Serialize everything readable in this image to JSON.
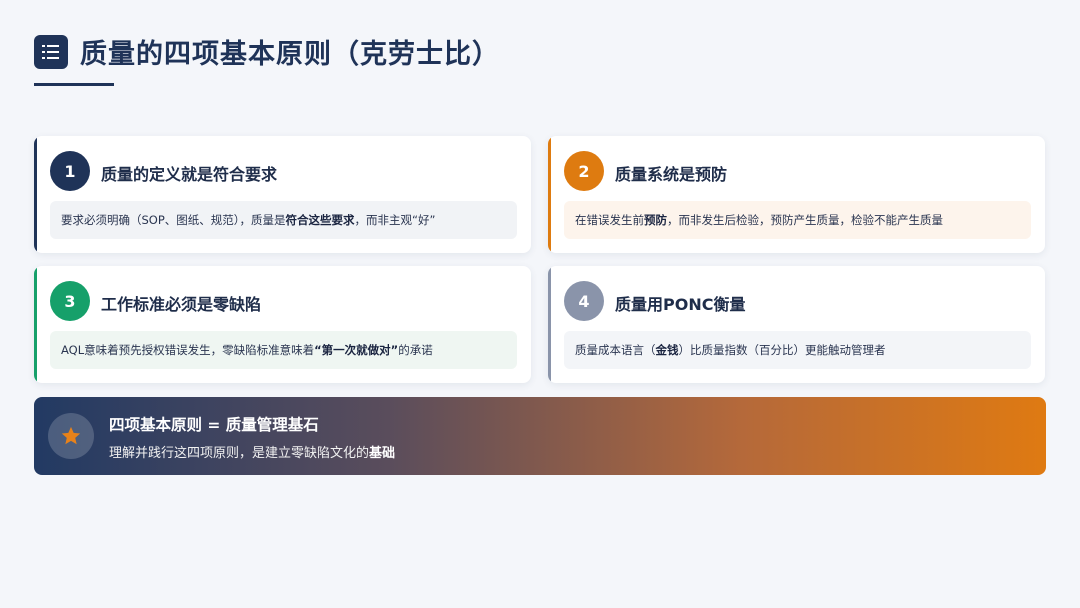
{
  "title": "质量的四项基本原则（克劳士比）",
  "title_icon": "list-icon",
  "colors": {
    "navy": "#1f3358",
    "orange": "#de7b10",
    "green": "#16a06a",
    "gray": "#8a94aa"
  },
  "cards": [
    {
      "number": "1",
      "heading": "质量的定义就是符合要求",
      "desc_before": "要求必须明确（SOP、图纸、规范），质量是",
      "desc_bold": "符合这些要求",
      "desc_after": "，而非主观“好”"
    },
    {
      "number": "2",
      "heading": "质量系统是预防",
      "desc_before": "在错误发生前",
      "desc_bold": "预防",
      "desc_after": "，而非发生后检验，预防产生质量，检验不能产生质量"
    },
    {
      "number": "3",
      "heading": "工作标准必须是零缺陷",
      "desc_before": "AQL意味着预先授权错误发生，零缺陷标准意味着",
      "desc_bold": "“第一次就做对”",
      "desc_after": "的承诺"
    },
    {
      "number": "4",
      "heading": "质量用PONC衡量",
      "desc_before": "质量成本语言（",
      "desc_bold": "金钱",
      "desc_after": "）比质量指数（百分比）更能触动管理者"
    }
  ],
  "summary": {
    "icon": "star-icon",
    "title": "四项基本原则 = 质量管理基石",
    "sub_before": "理解并践行这四项原则，是建立零缺陷文化的",
    "sub_bold": "基础"
  }
}
